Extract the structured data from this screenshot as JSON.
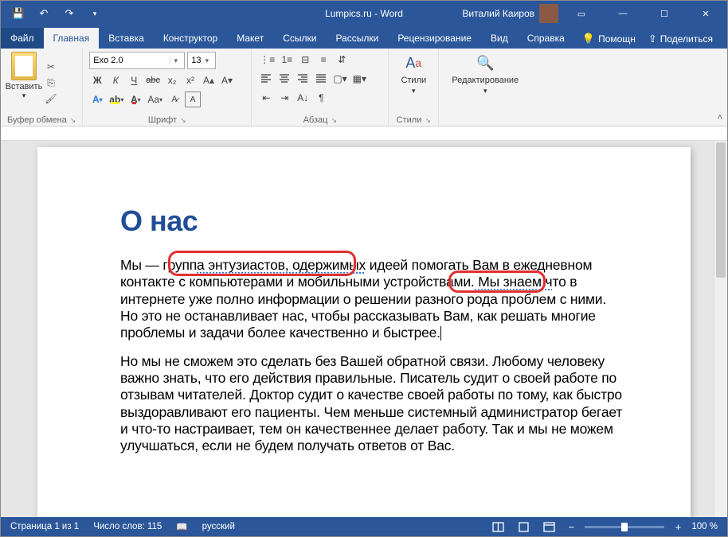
{
  "titlebar": {
    "title_left": "Lumpics.ru",
    "title_app": "Word",
    "user": "Виталий Каиров"
  },
  "tabs": {
    "file": "Файл",
    "items": [
      "Главная",
      "Вставка",
      "Конструктор",
      "Макет",
      "Ссылки",
      "Рассылки",
      "Рецензирование",
      "Вид",
      "Справка"
    ],
    "active": 0,
    "help": "Помощн",
    "share": "Поделиться"
  },
  "ribbon": {
    "clipboard": {
      "paste": "Вставить",
      "label": "Буфер обмена"
    },
    "font": {
      "name": "Exo 2.0",
      "size": "13",
      "label": "Шрифт",
      "bold": "Ж",
      "italic": "К",
      "underline": "Ч",
      "strike": "abc"
    },
    "paragraph": {
      "label": "Абзац"
    },
    "styles": {
      "btn": "Стили",
      "label": "Стили"
    },
    "editing": {
      "btn": "Редактирование"
    }
  },
  "document": {
    "heading": "О нас",
    "p1_a": "Мы — групп",
    "p1_squig1": "а энтузиастов, одержимых",
    "p1_b": " идеей помогать Вам в ежедневном контакте с компьютерами и мобильными устройствами.",
    "p1_squig2": " Мы знаем ч",
    "p1_c": "то в интернете уже полно информации о решении разного рода проблем с ними. Но это не останавливает нас, чтобы рассказывать Вам, как решать многие проблемы и задачи более качественно и быстрее.",
    "p2": "Но мы не сможем это сделать без Вашей обратной связи. Любому человеку важно знать, что его действия правильные. Писатель судит о своей работе по отзывам читателей. Доктор судит о качестве своей работы по тому, как быстро выздоравливают его пациенты. Чем меньше системный администратор бегает и что-то настраивает, тем он качественнее делает работу. Так и мы не можем улучшаться, если не будем получать ответов от Вас."
  },
  "statusbar": {
    "page": "Страница 1 из 1",
    "words": "Число слов: 115",
    "lang": "русский",
    "zoom": "100 %"
  }
}
